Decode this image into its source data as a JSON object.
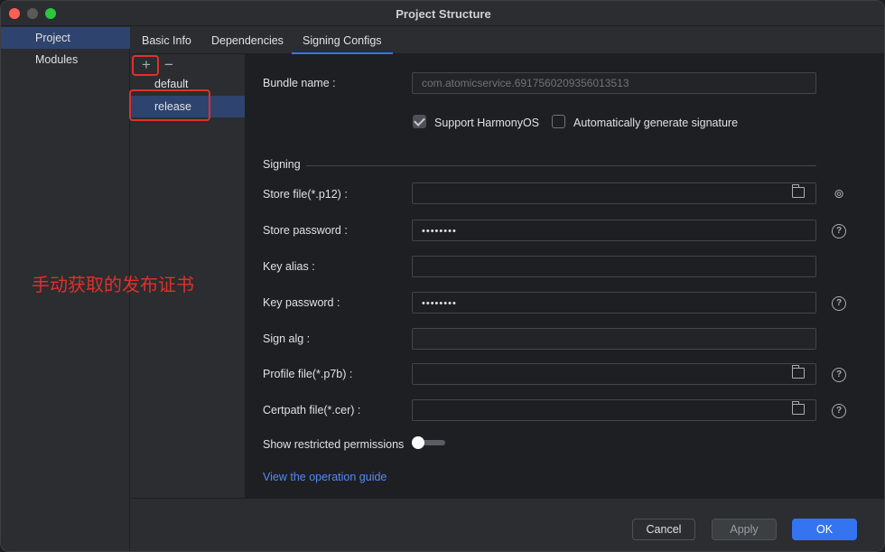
{
  "window": {
    "title": "Project Structure"
  },
  "nav": {
    "items": [
      {
        "label": "Project",
        "selected": true
      },
      {
        "label": "Modules",
        "selected": false
      }
    ]
  },
  "tabs": [
    {
      "label": "Basic Info",
      "active": false
    },
    {
      "label": "Dependencies",
      "active": false
    },
    {
      "label": "Signing Configs",
      "active": true
    }
  ],
  "configs": {
    "add_icon": "plus-icon",
    "remove_icon": "minus-icon",
    "items": [
      {
        "label": "default",
        "selected": false
      },
      {
        "label": "release",
        "selected": true
      }
    ]
  },
  "form": {
    "bundle_name": {
      "label": "Bundle name :",
      "value": "com.atomicservice.6917560209356013513"
    },
    "support_harmonyos": {
      "label": "Support HarmonyOS",
      "checked": true
    },
    "auto_signature": {
      "label": "Automatically generate signature",
      "checked": false
    },
    "signing_section": "Signing",
    "store_file": {
      "label": "Store file(*.p12) :",
      "value": ""
    },
    "store_password": {
      "label": "Store password :",
      "value": "••••••••"
    },
    "key_alias": {
      "label": "Key alias :",
      "value": ""
    },
    "key_password": {
      "label": "Key password :",
      "value": "••••••••"
    },
    "sign_alg": {
      "label": "Sign alg :",
      "value": ""
    },
    "profile_file": {
      "label": "Profile file(*.p7b) :",
      "value": ""
    },
    "certpath_file": {
      "label": "Certpath file(*.cer) :",
      "value": ""
    },
    "restricted_permissions": {
      "label": "Show restricted permissions",
      "enabled": false
    },
    "guide_link": "View the operation guide",
    "help_glyph": "?"
  },
  "footer": {
    "cancel": "Cancel",
    "apply": "Apply",
    "ok": "OK"
  },
  "annotation": {
    "text": "手动获取的发布证书",
    "color": "#e0302a"
  },
  "colors": {
    "accent": "#3574f0",
    "selection": "#2e436e",
    "link": "#548af7"
  }
}
